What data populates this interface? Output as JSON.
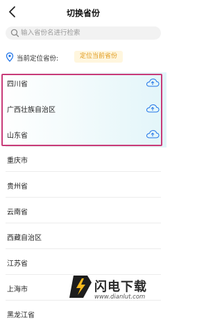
{
  "header": {
    "title": "切换省份"
  },
  "search": {
    "placeholder": "输入省份名进行检索"
  },
  "location": {
    "label": "当前定位省份:",
    "button": "定位当前省份"
  },
  "provinces": [
    "四川省",
    "广西壮族自治区",
    "山东省",
    "重庆市",
    "贵州省",
    "云南省",
    "西藏自治区",
    "江苏省",
    "上海市",
    "黑龙江省"
  ],
  "watermark": {
    "name": "闪电下载",
    "url": "www.dianlut.com"
  },
  "colors": {
    "accent": "#e09a1c",
    "highlight_border": "#c83a78",
    "icon": "#1f74e8"
  }
}
